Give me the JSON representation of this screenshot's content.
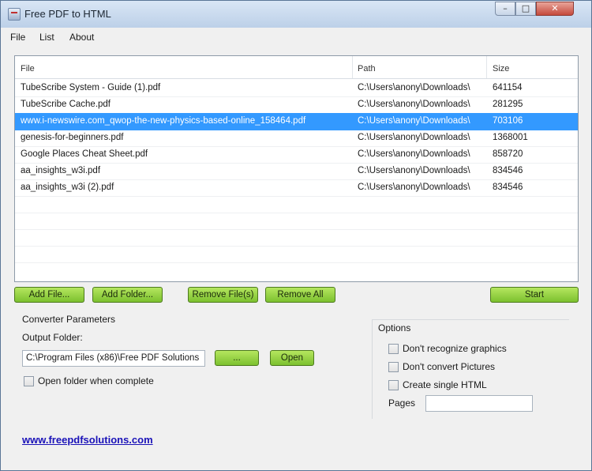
{
  "window": {
    "title": "Free PDF to HTML",
    "controls": {
      "minimize": "–",
      "maximize": "□",
      "close": "✕"
    }
  },
  "menu": [
    "File",
    "List",
    "About"
  ],
  "file_list": {
    "columns": [
      "File",
      "Path",
      "Size"
    ],
    "rows": [
      {
        "file": "TubeScribe System - Guide (1).pdf",
        "path": "C:\\Users\\anony\\Downloads\\",
        "size": "641154"
      },
      {
        "file": "TubeScribe Cache.pdf",
        "path": "C:\\Users\\anony\\Downloads\\",
        "size": "281295"
      },
      {
        "file": "www.i-newswire.com_qwop-the-new-physics-based-online_158464.pdf",
        "path": "C:\\Users\\anony\\Downloads\\",
        "size": "703106",
        "selected": true
      },
      {
        "file": "genesis-for-beginners.pdf",
        "path": "C:\\Users\\anony\\Downloads\\",
        "size": "1368001"
      },
      {
        "file": "Google Places Cheat Sheet.pdf",
        "path": "C:\\Users\\anony\\Downloads\\",
        "size": "858720"
      },
      {
        "file": "aa_insights_w3i.pdf",
        "path": "C:\\Users\\anony\\Downloads\\",
        "size": "834546"
      },
      {
        "file": "aa_insights_w3i (2).pdf",
        "path": "C:\\Users\\anony\\Downloads\\",
        "size": "834546"
      }
    ]
  },
  "buttons": {
    "add_file": "Add File...",
    "add_folder": "Add Folder...",
    "remove_files": "Remove File(s)",
    "remove_all": "Remove All",
    "start": "Start",
    "browse": "...",
    "open": "Open"
  },
  "converter": {
    "section_label": "Converter Parameters",
    "output_folder_label": "Output Folder:",
    "output_folder_value": "C:\\Program Files (x86)\\Free PDF Solutions",
    "open_when_complete": {
      "label": "Open folder when complete",
      "checked": false
    }
  },
  "options": {
    "section_label": "Options",
    "checks": [
      {
        "label": "Don't recognize graphics",
        "checked": false
      },
      {
        "label": "Don't convert Pictures",
        "checked": false
      },
      {
        "label": "Create single HTML",
        "checked": false
      }
    ],
    "pages_label": "Pages",
    "pages_value": ""
  },
  "footer_link": "www.freepdfsolutions.com"
}
